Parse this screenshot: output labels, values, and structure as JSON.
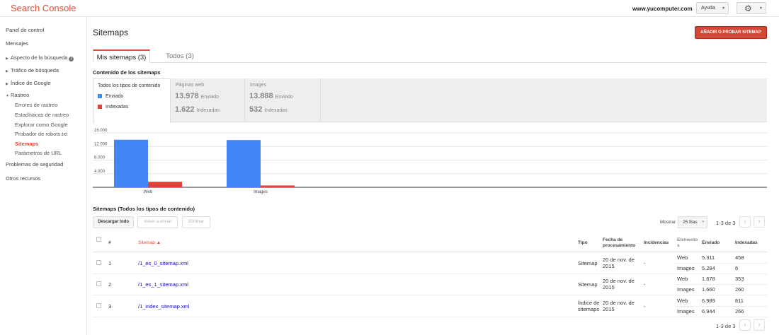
{
  "header": {
    "brand": "Search Console",
    "domain": "www.yucomputer.com",
    "help_label": "Ayuda",
    "caret": "▾",
    "settings_icon": "gear-icon"
  },
  "sidebar": {
    "items": [
      {
        "label": "Panel de control"
      },
      {
        "label": "Mensajes"
      },
      {
        "label": "Aspecto de la búsqueda",
        "tri": "▶"
      },
      {
        "label": "Tráfico de búsqueda",
        "tri": "▶"
      },
      {
        "label": "Índice de Google",
        "tri": "▶"
      },
      {
        "label": "Rastreo",
        "tri": "▼"
      }
    ],
    "info_mark": "i",
    "crawl_sub": [
      {
        "label": "Errores de rastreo"
      },
      {
        "label": "Estadísticas de rastreo"
      },
      {
        "label": "Explorar como Google"
      },
      {
        "label": "Probador de robots.txt"
      },
      {
        "label": "Sitemaps",
        "active": true
      },
      {
        "label": "Parámetros de URL"
      }
    ],
    "bottom_items": [
      {
        "label": "Problemas de seguridad"
      },
      {
        "label": "Otros recursos"
      }
    ]
  },
  "main": {
    "title": "Sitemaps",
    "add_button": "AÑADIR O PROBAR SITEMAP",
    "tabs": [
      {
        "label": "Mis sitemaps (3)",
        "active": true
      },
      {
        "label": "Todos (3)",
        "active": false
      }
    ],
    "content_title": "Contenido de los sitemaps",
    "filters": {
      "all": {
        "title": "Todos los tipos de contenido",
        "legend": [
          {
            "label": "Enviado",
            "color": "#4285f4"
          },
          {
            "label": "Indexadas",
            "color": "#db4437"
          }
        ]
      },
      "web": {
        "title": "Páginas web",
        "sent": "13.978",
        "sent_label": "Enviado",
        "indexed": "1.622",
        "indexed_label": "Indexadas"
      },
      "images": {
        "title": "Images",
        "sent": "13.888",
        "sent_label": "Enviado",
        "indexed": "532",
        "indexed_label": "Indexadas"
      }
    },
    "table_title": "Sitemaps (Todos los tipos de contenido)",
    "actions": {
      "download": "Descargar todo",
      "resend": "Volver a enviar",
      "delete": "Eliminar"
    },
    "show_label": "Mostrar",
    "rows_per_page": "25 filas",
    "pager": "1-3 de 3",
    "prev": "‹",
    "next": "›",
    "columns": {
      "num": "#",
      "sitemap": "Sitemap ▲",
      "type": "Tipo",
      "date": "Fecha de procesamiento",
      "issues": "Incidencias",
      "elements": "Elemento s",
      "sent": "Enviado",
      "indexed": "Indexadas"
    },
    "rows": [
      {
        "num": "1",
        "path": "/1_es_0_sitemap.xml",
        "type": "Sitemap",
        "date": "20 de nov. de 2015",
        "issues": "-",
        "items": [
          {
            "kind": "Web",
            "sent": "5.311",
            "indexed": "458"
          },
          {
            "kind": "Images",
            "sent": "5.284",
            "indexed": "6"
          }
        ]
      },
      {
        "num": "2",
        "path": "/1_es_1_sitemap.xml",
        "type": "Sitemap",
        "date": "20 de nov. de 2015",
        "issues": "-",
        "items": [
          {
            "kind": "Web",
            "sent": "1.678",
            "indexed": "353"
          },
          {
            "kind": "Images",
            "sent": "1.660",
            "indexed": "260"
          }
        ]
      },
      {
        "num": "3",
        "path": "/1_index_sitemap.xml",
        "type": "Índice de sitemaps",
        "date": "20 de nov. de 2015",
        "issues": "-",
        "items": [
          {
            "kind": "Web",
            "sent": "6.989",
            "indexed": "811"
          },
          {
            "kind": "Images",
            "sent": "6.944",
            "indexed": "266"
          }
        ]
      }
    ]
  },
  "chart_data": {
    "type": "bar",
    "categories": [
      "Web",
      "Images"
    ],
    "series": [
      {
        "name": "Enviado",
        "color": "#4285f4",
        "values": [
          13978,
          13888
        ]
      },
      {
        "name": "Indexadas",
        "color": "#db4437",
        "values": [
          1622,
          532
        ]
      }
    ],
    "yticks": [
      "16.000",
      "12.000",
      "8.000",
      "4.000"
    ],
    "ytick_values": [
      16000,
      12000,
      8000,
      4000
    ],
    "ylim": [
      0,
      16000
    ],
    "grid": true
  }
}
